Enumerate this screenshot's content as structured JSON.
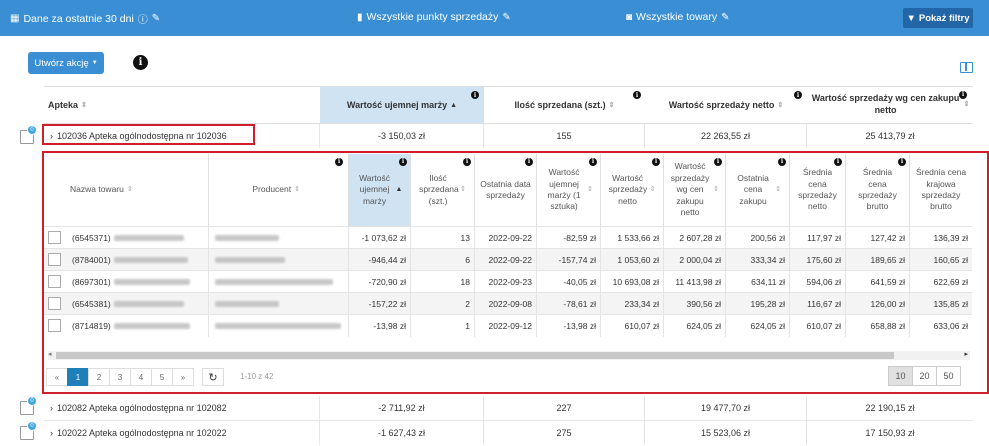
{
  "topbar": {
    "period": "Dane za ostatnie 30 dni",
    "points": "Wszystkie punkty sprzedaży",
    "products": "Wszystkie towary",
    "filters": "Pokaż filtry"
  },
  "actions": {
    "create": "Utwórz akcję"
  },
  "outer_headers": [
    "Apteka",
    "Wartość ujemnej marży",
    "Ilość sprzedana (szt.)",
    "Wartość sprzedaży netto",
    "Wartość sprzedaży wg cen zakupu netto"
  ],
  "outer_rows": [
    {
      "badge": "0",
      "name": "102036 Apteka ogólnodostępna nr 102036",
      "margin": "-3 150,03 zł",
      "qty": "155",
      "net": "22 263,55 zł",
      "purchase": "25 413,79 zł"
    },
    {
      "badge": "0",
      "name": "102082 Apteka ogólnodostępna nr 102082",
      "margin": "-2 711,92 zł",
      "qty": "227",
      "net": "19 477,70 zł",
      "purchase": "22 190,15 zł"
    },
    {
      "badge": "0",
      "name": "102022 Apteka ogólnodostępna nr 102022",
      "margin": "-1 627,43 zł",
      "qty": "275",
      "net": "15 523,06 zł",
      "purchase": "17 150,93 zł"
    }
  ],
  "inner_headers": [
    "Nazwa towaru",
    "Producent",
    "Wartość ujemnej marży",
    "Ilość sprzedana (szt.)",
    "Ostatnia data sprzedaży",
    "Wartość ujemnej marży (1 sztuka)",
    "Wartość sprzedaży netto",
    "Wartość sprzedaży wg cen zakupu netto",
    "Ostatnia cena zakupu",
    "Średnia cena sprzedaży netto",
    "Średnia cena sprzedaży brutto",
    "Średnia cena krajowa sprzedaży brutto"
  ],
  "inner_rows": [
    {
      "code": "(6545371)",
      "margin": "-1 073,62 zł",
      "qty": "13",
      "date": "2022-09-22",
      "unit": "-82,59 zł",
      "net": "1 533,66 zł",
      "purchase": "2 607,28 zł",
      "last": "200,56 zł",
      "avg_net": "117,97 zł",
      "avg_gross": "127,42 zł",
      "nat": "136,39 zł"
    },
    {
      "code": "(8784001)",
      "margin": "-946,44 zł",
      "qty": "6",
      "date": "2022-09-22",
      "unit": "-157,74 zł",
      "net": "1 053,60 zł",
      "purchase": "2 000,04 zł",
      "last": "333,34 zł",
      "avg_net": "175,60 zł",
      "avg_gross": "189,65 zł",
      "nat": "160,65 zł"
    },
    {
      "code": "(8697301)",
      "margin": "-720,90 zł",
      "qty": "18",
      "date": "2022-09-23",
      "unit": "-40,05 zł",
      "net": "10 693,08 zł",
      "purchase": "11 413,98 zł",
      "last": "634,11 zł",
      "avg_net": "594,06 zł",
      "avg_gross": "641,59 zł",
      "nat": "622,69 zł"
    },
    {
      "code": "(6545381)",
      "margin": "-157,22 zł",
      "qty": "2",
      "date": "2022-09-08",
      "unit": "-78,61 zł",
      "net": "233,34 zł",
      "purchase": "390,56 zł",
      "last": "195,28 zł",
      "avg_net": "116,67 zł",
      "avg_gross": "126,00 zł",
      "nat": "135,85 zł"
    },
    {
      "code": "(8714819)",
      "margin": "-13,98 zł",
      "qty": "1",
      "date": "2022-09-12",
      "unit": "-13,98 zł",
      "net": "610,07 zł",
      "purchase": "624,05 zł",
      "last": "624,05 zł",
      "avg_net": "610,07 zł",
      "avg_gross": "658,88 zł",
      "nat": "633,06 zł"
    }
  ],
  "pagination": {
    "prev": "«",
    "next": "»",
    "pages": [
      "1",
      "2",
      "3",
      "4",
      "5"
    ],
    "active": "1",
    "refresh": "↻",
    "range": "1-10 z 42",
    "sizes": [
      "10",
      "20",
      "50"
    ],
    "size_active": "10"
  }
}
